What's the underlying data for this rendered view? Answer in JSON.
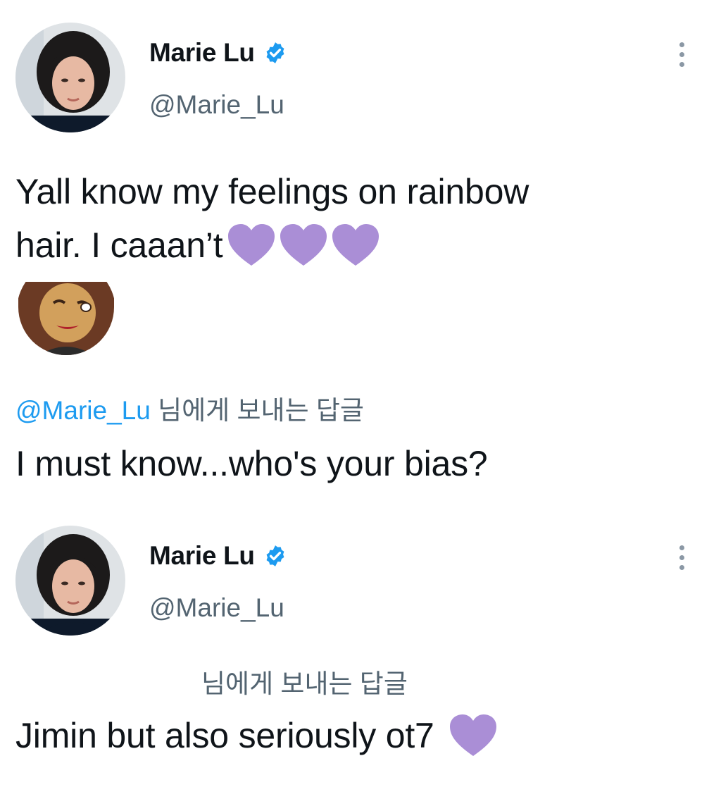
{
  "tweet1": {
    "display_name": "Marie Lu",
    "handle": "@Marie_Lu",
    "text_line1": "Yall know my feelings on rainbow",
    "text_line2": "hair. I caaan’t",
    "emoji": [
      "purple-heart",
      "purple-heart",
      "purple-heart"
    ]
  },
  "reply1": {
    "reply_mention": "@Marie_Lu",
    "reply_suffix": " 님에게 보내는 답글",
    "text": "I must know...who's your bias?"
  },
  "tweet2": {
    "display_name": "Marie Lu",
    "handle": "@Marie_Lu",
    "reply_suffix": "님에게 보내는 답글",
    "text": "Jimin but also seriously ot7",
    "emoji": [
      "purple-heart"
    ]
  },
  "colors": {
    "purple_heart": "#AA8ED6",
    "verified_badge": "#1D9BF0",
    "mention": "#1D9BF0",
    "secondary_text": "#536471"
  }
}
